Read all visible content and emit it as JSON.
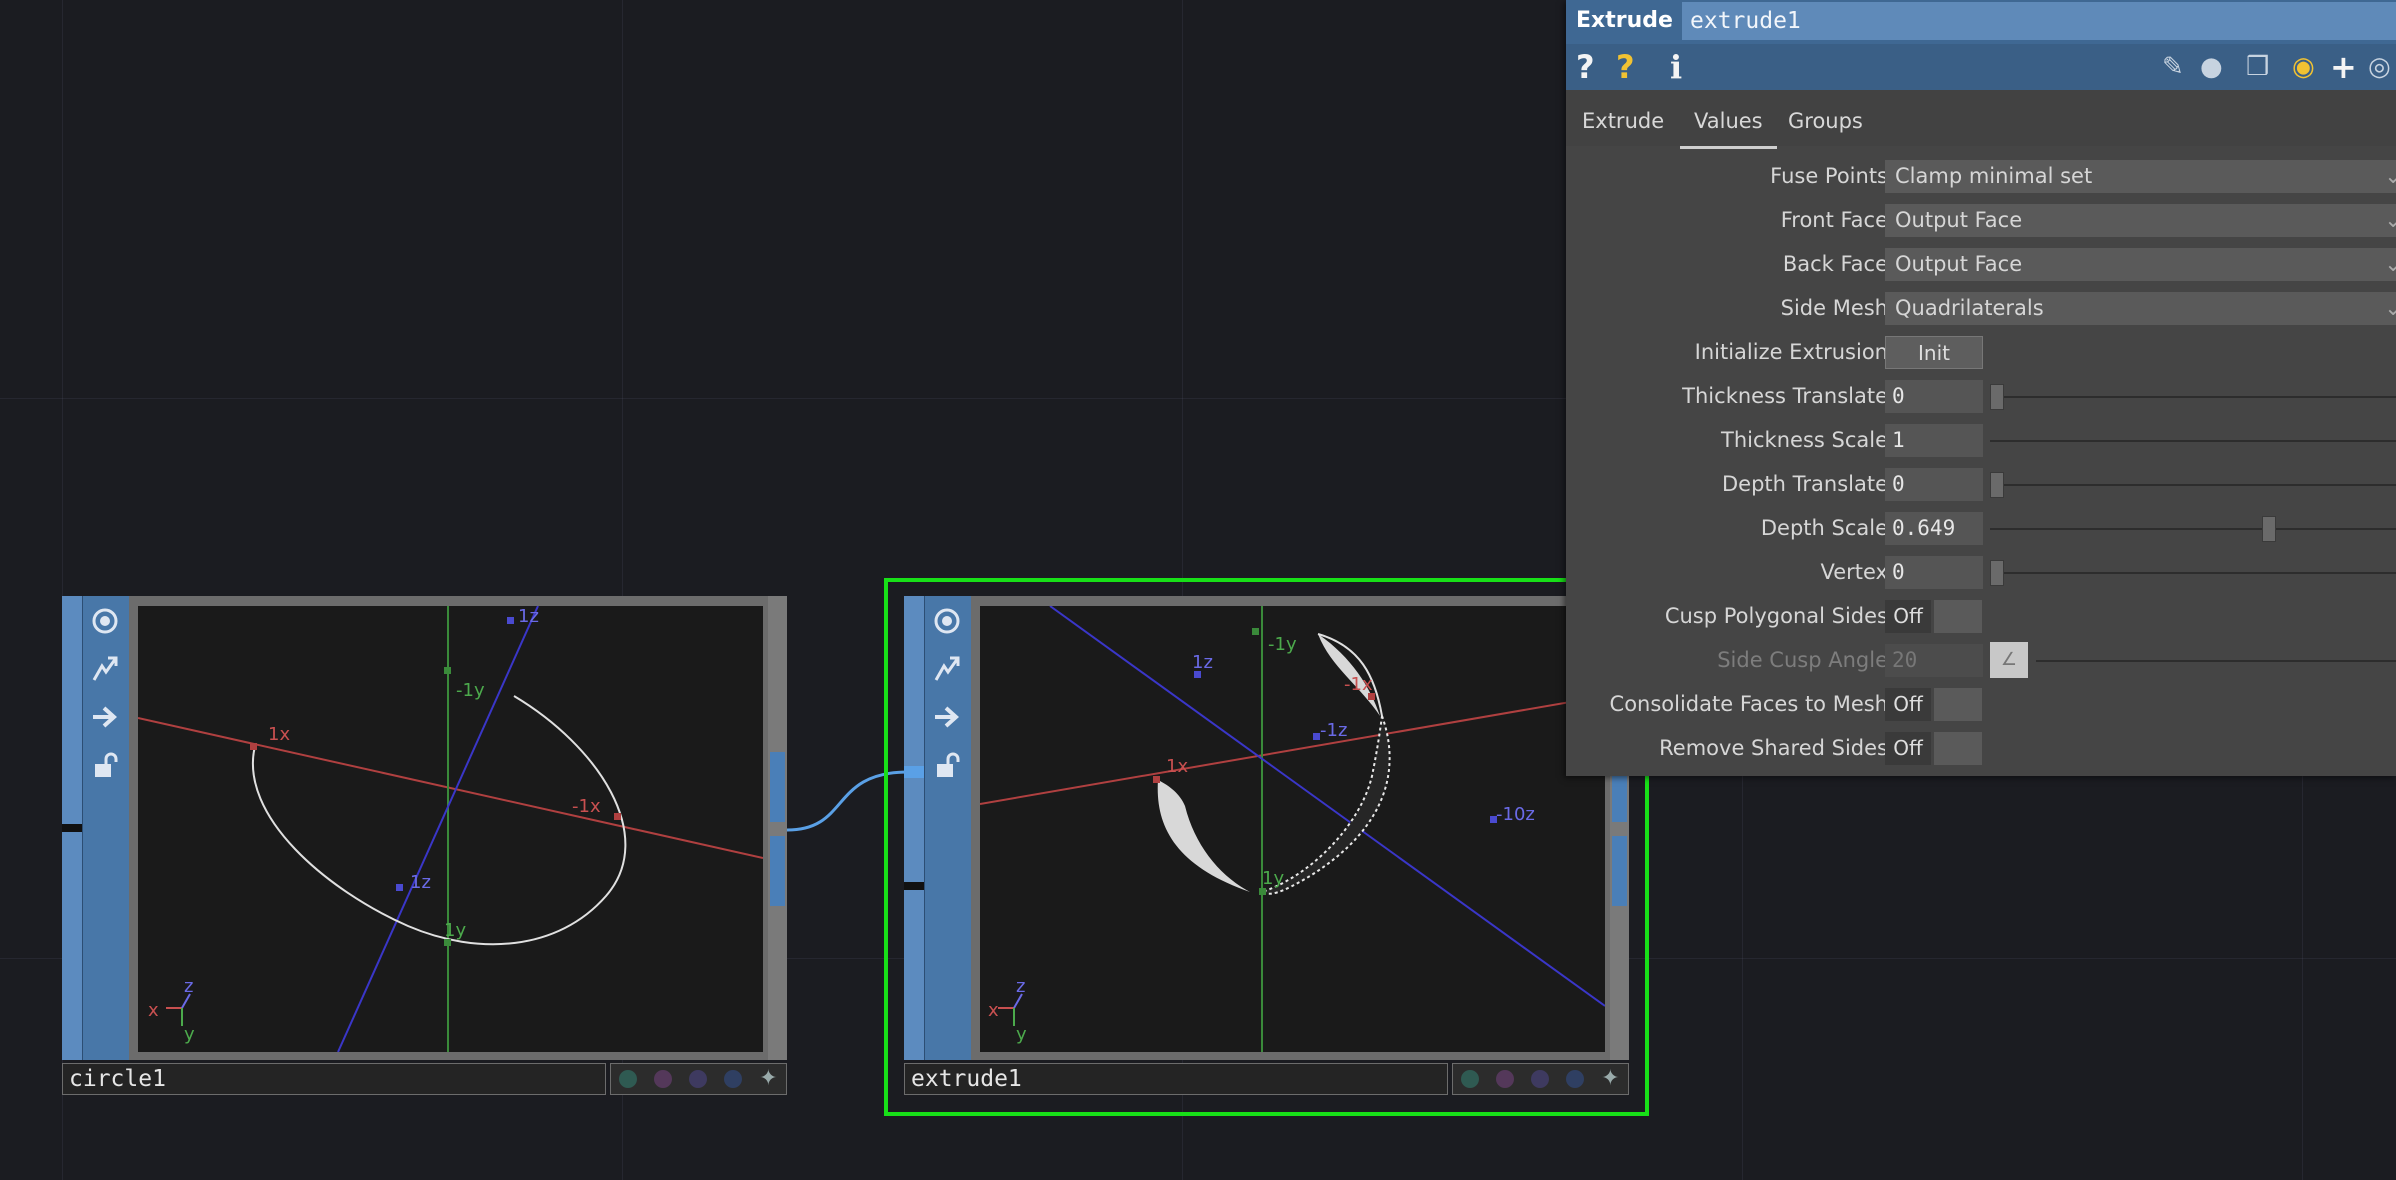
{
  "nodes": {
    "circle": {
      "name": "circle1",
      "viewer": {
        "axis_labels": [
          "1z",
          "-1y",
          "1x",
          "-1x",
          "1z",
          "1y"
        ],
        "gizmo": [
          "x",
          "z",
          "y"
        ]
      }
    },
    "extrude": {
      "name": "extrude1",
      "viewer": {
        "axis_labels": [
          "-1y",
          "1z",
          "-1x",
          "1x",
          "-1z",
          "1y",
          "-10z"
        ],
        "gizmo": [
          "x",
          "z",
          "y"
        ]
      }
    }
  },
  "params": {
    "op_type": "Extrude",
    "op_name": "extrude1",
    "toolbar": {
      "help": "?",
      "python_help": "?",
      "info": "i",
      "icons": [
        "edit-icon",
        "comment-icon",
        "clone-icon",
        "python-icon",
        "add-icon",
        "viewer-icon"
      ]
    },
    "tabs": [
      {
        "label": "Extrude",
        "active": false
      },
      {
        "label": "Values",
        "active": true
      },
      {
        "label": "Groups",
        "active": false
      }
    ],
    "rows": {
      "fuse_points": {
        "label": "Fuse Points",
        "value": "Clamp minimal set"
      },
      "front_face": {
        "label": "Front Face",
        "value": "Output Face"
      },
      "back_face": {
        "label": "Back Face",
        "value": "Output Face"
      },
      "side_mesh": {
        "label": "Side Mesh",
        "value": "Quadrilaterals"
      },
      "init_extrusion": {
        "label": "Initialize Extrusion",
        "button": "Init"
      },
      "thickness_translate": {
        "label": "Thickness Translate",
        "value": "0"
      },
      "thickness_scale": {
        "label": "Thickness Scale",
        "value": "1"
      },
      "depth_translate": {
        "label": "Depth Translate",
        "value": "0"
      },
      "depth_scale": {
        "label": "Depth Scale",
        "value": "0.649"
      },
      "vertex": {
        "label": "Vertex",
        "value": "0"
      },
      "cusp_polygonal_sides": {
        "label": "Cusp Polygonal Sides",
        "value": "Off"
      },
      "side_cusp_angle": {
        "label": "Side Cusp Angle",
        "value": "20"
      },
      "consolidate_faces": {
        "label": "Consolidate Faces to Mesh",
        "value": "Off"
      },
      "remove_shared_sides": {
        "label": "Remove Shared Sides",
        "value": "Off"
      }
    }
  },
  "colors": {
    "accent_blue": "#4877a8",
    "selection_green": "#18e018",
    "x_axis": "#b04040",
    "y_axis": "#3a8a3a",
    "z_axis": "#4a4ad0",
    "wire": "#5aa0e6"
  }
}
